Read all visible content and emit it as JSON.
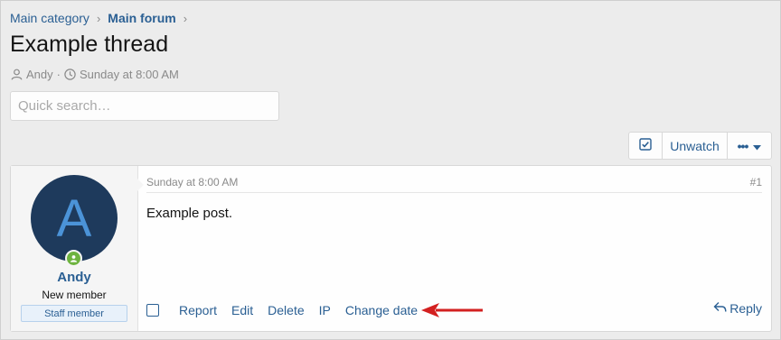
{
  "breadcrumb": {
    "items": [
      "Main category",
      "Main forum"
    ],
    "separator": "›"
  },
  "thread": {
    "title": "Example thread",
    "author": "Andy",
    "separator": "·",
    "date": "Sunday at 8:00 AM"
  },
  "search": {
    "placeholder": "Quick search…"
  },
  "thread_actions": {
    "unwatch_label": "Unwatch",
    "more_label": "•••"
  },
  "post": {
    "avatar_letter": "A",
    "username": "Andy",
    "user_title": "New member",
    "banner": "Staff member",
    "date": "Sunday at 8:00 AM",
    "number": "#1",
    "body": "Example post.",
    "actions": [
      "Report",
      "Edit",
      "Delete",
      "IP",
      "Change date"
    ],
    "reply_label": "Reply"
  },
  "colors": {
    "link": "#2a5f93",
    "annotation_arrow": "#d32020",
    "online": "#6db33f",
    "avatar_bg": "#1e3a5c"
  },
  "icons": [
    "user-icon",
    "clock-icon",
    "checkbox-check-icon",
    "caret-down-icon",
    "reply-icon",
    "annotation-arrow-icon"
  ]
}
